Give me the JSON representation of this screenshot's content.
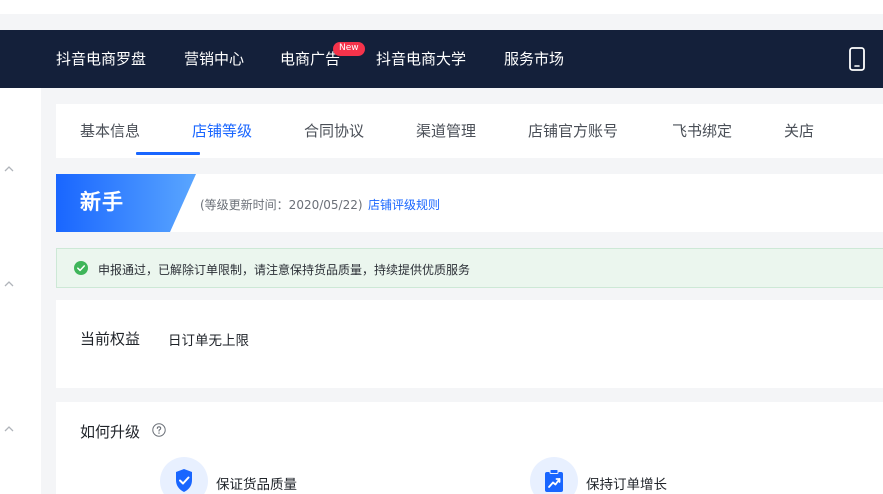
{
  "nav": {
    "items": [
      {
        "label": "抖音电商罗盘"
      },
      {
        "label": "营销中心"
      },
      {
        "label": "电商广告"
      },
      {
        "label": "抖音电商大学"
      },
      {
        "label": "服务市场"
      }
    ],
    "badge": "New"
  },
  "tabs": [
    {
      "label": "基本信息"
    },
    {
      "label": "店铺等级",
      "active": true
    },
    {
      "label": "合同协议"
    },
    {
      "label": "渠道管理"
    },
    {
      "label": "店铺官方账号"
    },
    {
      "label": "飞书绑定"
    },
    {
      "label": "关店"
    }
  ],
  "level": {
    "name": "新手",
    "update_time": "(等级更新时间：2020/05/22)",
    "rule_link": "店铺评级规则"
  },
  "notice": {
    "text": "申报通过，已解除订单限制，请注意保持货品质量，持续提供优质服务"
  },
  "rights": {
    "label": "当前权益",
    "value": "日订单无上限"
  },
  "upgrade": {
    "title": "如何升级",
    "items": [
      {
        "label": "保证货品质量",
        "icon": "shield-check-icon"
      },
      {
        "label": "保持订单增长",
        "icon": "trend-up-icon"
      }
    ]
  },
  "colors": {
    "nav_bg": "#14203a",
    "accent": "#1966ff",
    "success": "#3fb55a",
    "badge": "#f5334b"
  }
}
